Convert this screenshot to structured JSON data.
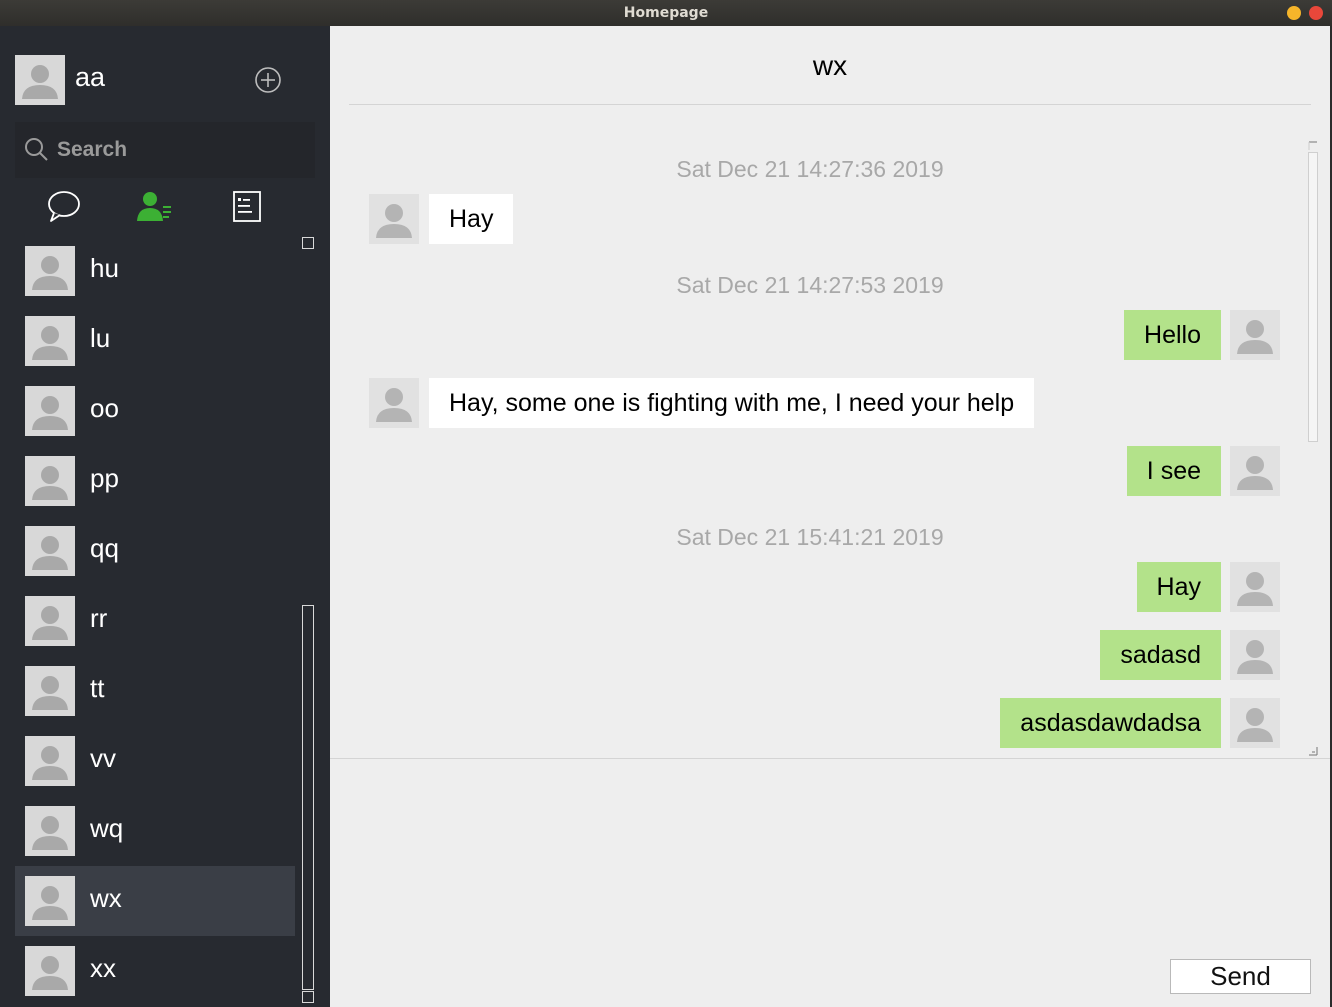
{
  "window": {
    "title": "Homepage"
  },
  "user": {
    "name": "aa"
  },
  "search": {
    "placeholder": "Search"
  },
  "tabs": [
    {
      "icon": "chat-bubble-icon",
      "active": false
    },
    {
      "icon": "contacts-icon",
      "active": true,
      "color": "#3cb034"
    },
    {
      "icon": "list-icon",
      "active": false
    }
  ],
  "contacts": [
    {
      "name": "hu",
      "selected": false
    },
    {
      "name": "lu",
      "selected": false
    },
    {
      "name": "oo",
      "selected": false
    },
    {
      "name": "pp",
      "selected": false
    },
    {
      "name": "qq",
      "selected": false
    },
    {
      "name": "rr",
      "selected": false
    },
    {
      "name": "tt",
      "selected": false
    },
    {
      "name": "vv",
      "selected": false
    },
    {
      "name": "wq",
      "selected": false
    },
    {
      "name": "wx",
      "selected": true
    },
    {
      "name": "xx",
      "selected": false
    }
  ],
  "chat": {
    "title": "wx",
    "timestamps": [
      "Sat Dec 21 14:27:36 2019",
      "Sat Dec 21 14:27:53 2019",
      "Sat Dec 21 15:41:21 2019"
    ],
    "messages": [
      {
        "direction": "in",
        "text": "Hay"
      },
      {
        "direction": "out",
        "text": "Hello"
      },
      {
        "direction": "in",
        "text": "Hay, some one is fighting with me, I need your help"
      },
      {
        "direction": "out",
        "text": "I see"
      },
      {
        "direction": "out",
        "text": "Hay"
      },
      {
        "direction": "out",
        "text": "sadasd"
      },
      {
        "direction": "out",
        "text": "asdasdawdadsa"
      }
    ]
  },
  "composer": {
    "send_label": "Send"
  },
  "colors": {
    "sidebar_bg": "#272a30",
    "selected_bg": "#3a3e46",
    "outgoing_bubble": "#b3e28a",
    "incoming_bubble": "#ffffff",
    "chat_bg": "#eeeeee",
    "active_tab": "#3cb034"
  }
}
